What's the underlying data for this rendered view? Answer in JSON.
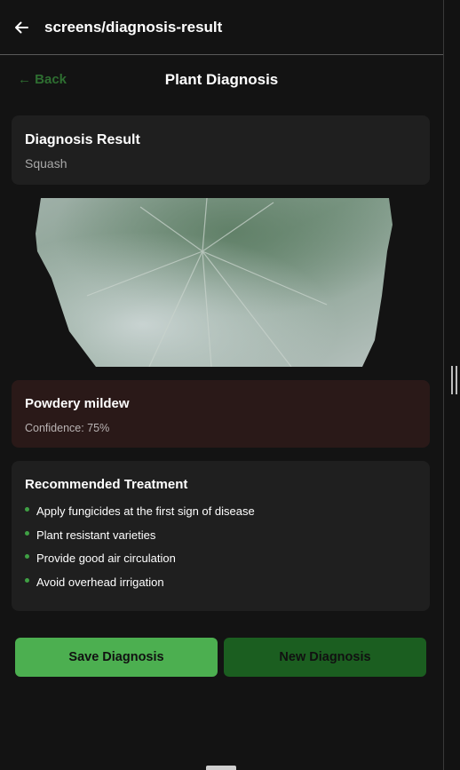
{
  "header": {
    "title": "screens/diagnosis-result",
    "back_icon": "arrow-left-icon"
  },
  "nav": {
    "back_label": "← Back",
    "page_title": "Plant Diagnosis"
  },
  "result": {
    "heading": "Diagnosis Result",
    "plant": "Squash"
  },
  "image": {
    "alt": "squash-leaf-photo"
  },
  "disease": {
    "name": "Powdery mildew",
    "confidence": "Confidence: 75%"
  },
  "treatment": {
    "heading": "Recommended Treatment",
    "items": [
      "Apply fungicides at the first sign of disease",
      "Plant resistant varieties",
      "Provide good air circulation",
      "Avoid overhead irrigation"
    ]
  },
  "actions": {
    "save_label": "Save Diagnosis",
    "new_label": "New Diagnosis"
  },
  "colors": {
    "accent": "#4caf50",
    "accent_dark": "#1b5e20",
    "disease_bg": "#2a1918"
  }
}
